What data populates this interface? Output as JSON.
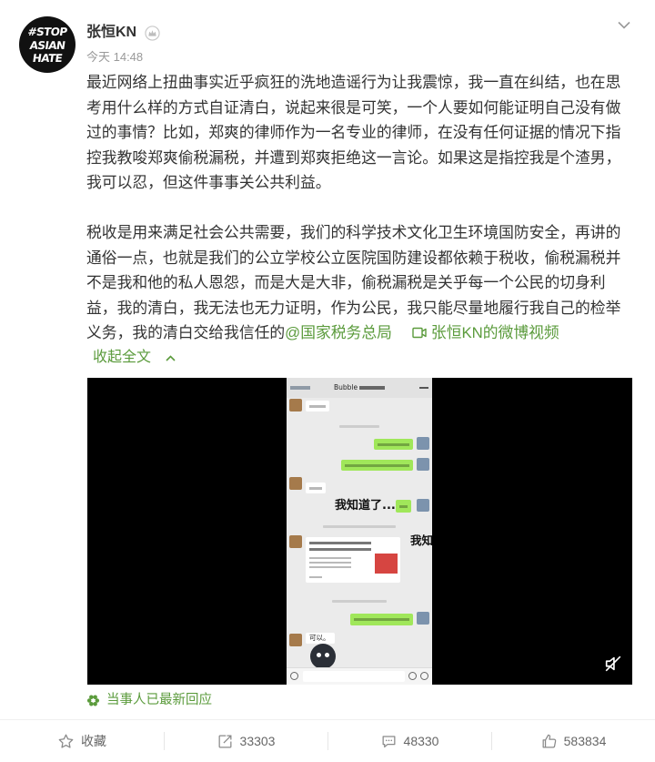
{
  "post": {
    "author": {
      "name": "张恒KN",
      "avatar_text": [
        "#STOP",
        "ASIAN",
        "HATE"
      ],
      "badge_icon": "member-badge-icon"
    },
    "timestamp": "今天 14:48",
    "menu_icon": "chevron-down-icon",
    "paragraphs": [
      {
        "lines": [
          "最近网络上扭曲事实近乎疯狂的洗地造谣行为让我震惊，我一直在纠结，也在思",
          "考用什么样的方式自证清白，说起来很是可笑，一个人要如何能证明自己没有做",
          "过的事情？比如，郑爽的律师作为一名专业的律师，在没有任何证据的情况下指",
          "控我教唆郑爽偷税漏税，并遭到郑爽拒绝这一言论。如果这是指控我是个渣男，",
          "我可以忍，但这件事事关公共利益。"
        ]
      },
      {
        "lines": [
          "税收是用来满足社会公共需要，我们的科学技术文化卫生环境国防安全，再讲的",
          "通俗一点，也就是我们的公立学校公立医院国防建设都依赖于税收，偷税漏税并",
          "不是我和他的私人恩怨，而是大是大非，偷税漏税是关乎每一个公民的切身利",
          "益，我的清白，我无法也无力证明，作为公民，我只能尽量地履行我自己的检举"
        ]
      }
    ],
    "closing_line": {
      "text": "义务，我的清白交给我信任的",
      "mention": "@国家税务总局",
      "video_link_icon": "video-link-icon",
      "video_link": "张恒KN的微博视频"
    },
    "collapse": {
      "label": "收起全文",
      "icon": "chevron-up-icon"
    },
    "video": {
      "mute_icon": "mute-icon",
      "frame": {
        "chat_title": "Bubble",
        "subtitle": "我知道了...",
        "subtitle_echo": "我知",
        "reply": "可以。"
      }
    },
    "update_notice": {
      "icon": "flower-icon",
      "label": "当事人已最新回应"
    }
  },
  "actions": [
    {
      "icon": "star-icon",
      "label": "收藏"
    },
    {
      "icon": "forward-icon",
      "label": "33303"
    },
    {
      "icon": "comment-icon",
      "label": "48330"
    },
    {
      "icon": "like-icon",
      "label": "583834"
    }
  ],
  "colors": {
    "text": "#333333",
    "muted": "#999999",
    "link": "#5b9b3c",
    "video_background": "#000000",
    "chat_background": "#ebebeb",
    "chat_bubble_outgoing": "#a0e75a"
  }
}
